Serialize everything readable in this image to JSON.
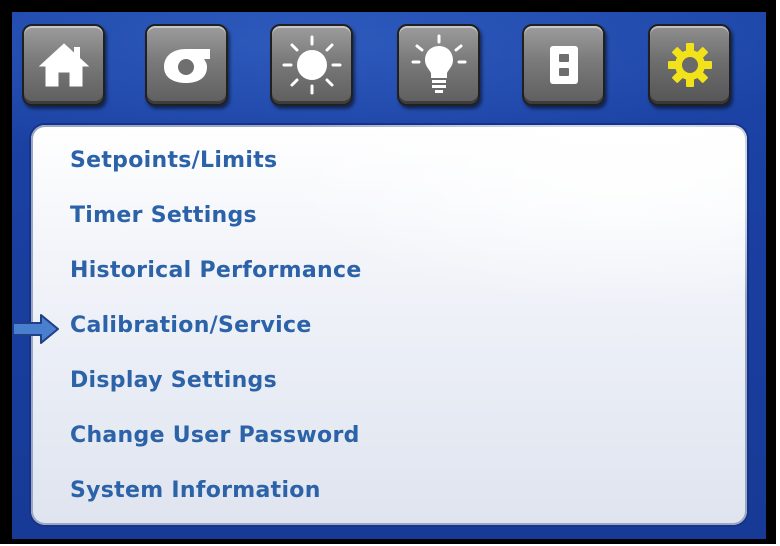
{
  "toolbar": {
    "buttons": [
      {
        "icon": "home-icon"
      },
      {
        "icon": "fan-icon"
      },
      {
        "icon": "sun-icon"
      },
      {
        "icon": "light-bulb-icon"
      },
      {
        "icon": "panel-icon"
      },
      {
        "icon": "gear-icon",
        "active": true
      }
    ]
  },
  "menu": {
    "items": [
      {
        "label": "Setpoints/Limits"
      },
      {
        "label": "Timer Settings"
      },
      {
        "label": "Historical Performance"
      },
      {
        "label": "Calibration/Service",
        "selected": true
      },
      {
        "label": "Display Settings"
      },
      {
        "label": "Change User Password"
      },
      {
        "label": "System Information"
      }
    ]
  },
  "colors": {
    "background": "#1a3fa0",
    "menu_text": "#2b62a8",
    "selector_arrow": "#4a7fd0",
    "gear_accent": "#f2e21a"
  }
}
